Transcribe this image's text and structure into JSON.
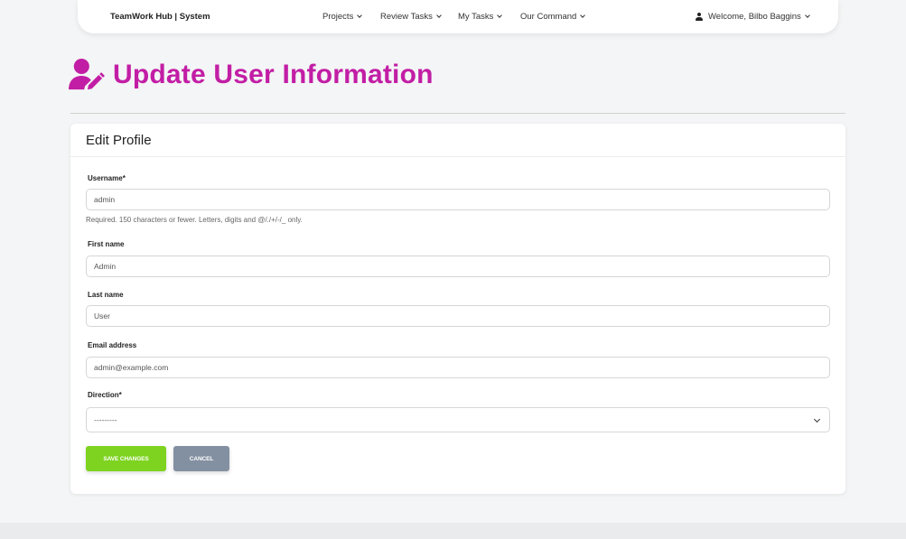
{
  "navbar": {
    "brand": "TeamWork Hub | System",
    "links": [
      {
        "label": "Projects"
      },
      {
        "label": "Review Tasks"
      },
      {
        "label": "My Tasks"
      },
      {
        "label": "Our Command"
      }
    ],
    "user_menu": "Welcome, Bilbo Baggins"
  },
  "page": {
    "title": "Update User Information",
    "title_color": "#c21ea5"
  },
  "card": {
    "header": "Edit Profile",
    "fields": {
      "username": {
        "label": "Username*",
        "value": "admin",
        "help": "Required. 150 characters or fewer. Letters, digits and @/./+/-/_ only."
      },
      "first_name": {
        "label": "First name",
        "value": "Admin"
      },
      "last_name": {
        "label": "Last name",
        "value": "User"
      },
      "email": {
        "label": "Email address",
        "value": "admin@example.com"
      },
      "direction": {
        "label": "Direction*",
        "selected": "---------"
      }
    },
    "buttons": {
      "save": "SAVE CHANGES",
      "save_color": "#7ed321",
      "cancel": "CANCEL",
      "cancel_color": "#8390a1"
    }
  },
  "icons": {
    "nav_dropdown": "chevron-down-icon",
    "user": "user-icon",
    "title": "user-edit-icon"
  }
}
